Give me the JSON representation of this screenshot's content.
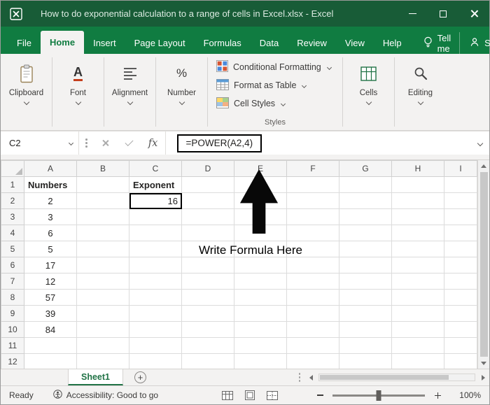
{
  "titlebar": {
    "title": "How to do exponential calculation to a range of cells in Excel.xlsx  -  Excel"
  },
  "ribbon_tabs": {
    "tabs": [
      {
        "label": "File"
      },
      {
        "label": "Home",
        "active": true
      },
      {
        "label": "Insert"
      },
      {
        "label": "Page Layout"
      },
      {
        "label": "Formulas"
      },
      {
        "label": "Data"
      },
      {
        "label": "Review"
      },
      {
        "label": "View"
      },
      {
        "label": "Help"
      }
    ],
    "tell_me": "Tell me",
    "share": "Share"
  },
  "ribbon": {
    "groups_left": [
      {
        "label": "Clipboard"
      },
      {
        "label": "Font"
      },
      {
        "label": "Alignment"
      },
      {
        "label": "Number"
      }
    ],
    "styles": {
      "items": [
        {
          "label": "Conditional Formatting"
        },
        {
          "label": "Format as Table"
        },
        {
          "label": "Cell Styles"
        }
      ],
      "group_label": "Styles"
    },
    "groups_right": [
      {
        "label": "Cells"
      },
      {
        "label": "Editing"
      }
    ]
  },
  "formula_bar": {
    "name_box": "C2",
    "fx_label": "fx",
    "formula": "=POWER(A2,4)"
  },
  "grid": {
    "columns": [
      "A",
      "B",
      "C",
      "D",
      "E",
      "F",
      "G",
      "H",
      "I"
    ],
    "row_count": 12,
    "selected_cell": "C2",
    "cells": [
      {
        "ref": "A1",
        "value": "Numbers",
        "bold": true,
        "align": "left"
      },
      {
        "ref": "C1",
        "value": "Exponent",
        "bold": true,
        "align": "left"
      },
      {
        "ref": "A2",
        "value": "2",
        "align": "center"
      },
      {
        "ref": "C2",
        "value": "16",
        "align": "right",
        "selected": true
      },
      {
        "ref": "A3",
        "value": "3",
        "align": "center"
      },
      {
        "ref": "A4",
        "value": "6",
        "align": "center"
      },
      {
        "ref": "A5",
        "value": "5",
        "align": "center"
      },
      {
        "ref": "A6",
        "value": "17",
        "align": "center"
      },
      {
        "ref": "A7",
        "value": "12",
        "align": "center"
      },
      {
        "ref": "A8",
        "value": "57",
        "align": "center"
      },
      {
        "ref": "A9",
        "value": "39",
        "align": "center"
      },
      {
        "ref": "A10",
        "value": "84",
        "align": "center"
      }
    ]
  },
  "annotation": {
    "text": "Write Formula Here"
  },
  "sheet_bar": {
    "tabs": [
      {
        "label": "Sheet1",
        "active": true
      }
    ],
    "add_sheet_label": "+"
  },
  "status_bar": {
    "mode": "Ready",
    "accessibility": "Accessibility: Good to go",
    "zoom_level": "100%"
  },
  "colors": {
    "titlebar_green": "#185C37",
    "ribbon_green": "#107C41",
    "active_tab_green": "#107C41",
    "sheet_tab_green": "#217346",
    "selection_border": "#000000"
  }
}
